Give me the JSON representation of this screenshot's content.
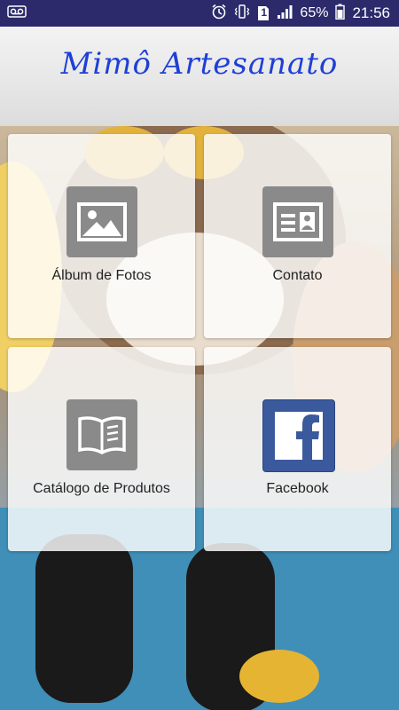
{
  "status_bar": {
    "battery_percent": "65%",
    "time": "21:56",
    "sim_label": "1",
    "icons": [
      "voicemail-icon",
      "alarm-icon",
      "vibrate-icon",
      "sim-icon",
      "signal-icon",
      "battery-icon"
    ]
  },
  "header": {
    "title": "Mimô Artesanato"
  },
  "colors": {
    "status_bar": "#2c2a6b",
    "title": "#1f3fd6",
    "tile_icon_bg": "#8a8a8a",
    "facebook_blue": "#3b5a9d"
  },
  "tiles": [
    {
      "label": "Álbum de Fotos",
      "icon": "photo-icon"
    },
    {
      "label": "Contato",
      "icon": "contact-card-icon"
    },
    {
      "label": "Catálogo de Produtos",
      "icon": "book-icon"
    },
    {
      "label": "Facebook",
      "icon": "facebook-icon"
    }
  ]
}
